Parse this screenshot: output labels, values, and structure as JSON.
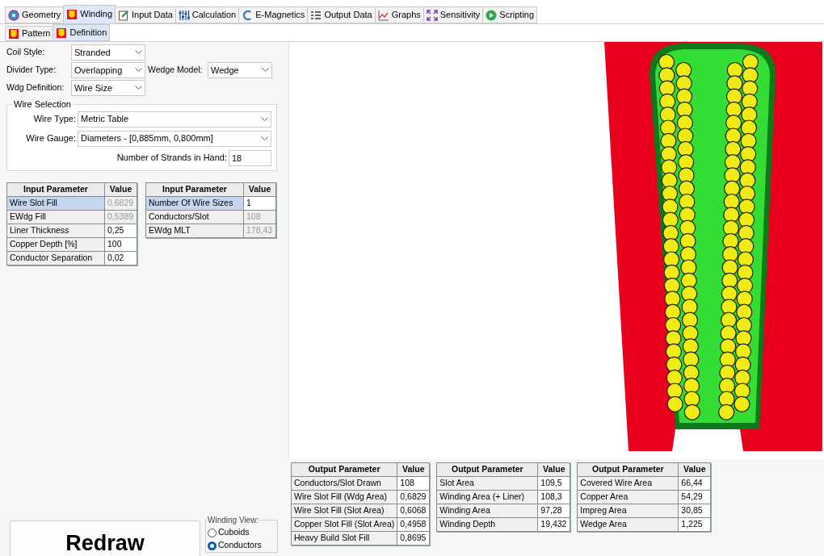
{
  "tabs": [
    {
      "label": "Geometry",
      "selected": false
    },
    {
      "label": "Winding",
      "selected": true
    },
    {
      "label": "Input Data",
      "selected": false
    },
    {
      "label": "Calculation",
      "selected": false
    },
    {
      "label": "E-Magnetics",
      "selected": false
    },
    {
      "label": "Output Data",
      "selected": false
    },
    {
      "label": "Graphs",
      "selected": false
    },
    {
      "label": "Sensitivity",
      "selected": false
    },
    {
      "label": "Scripting",
      "selected": false
    }
  ],
  "subtabs": [
    {
      "label": "Pattern",
      "selected": false
    },
    {
      "label": "Definition",
      "selected": true
    }
  ],
  "settings": {
    "coil_style": {
      "label": "Coil Style:",
      "value": "Stranded"
    },
    "divider_type": {
      "label": "Divider Type:",
      "value": "Overlapping"
    },
    "wedge_model": {
      "label": "Wedge Model:",
      "value": "Wedge"
    },
    "wdg_definition": {
      "label": "Wdg Definition:",
      "value": "Wire Size"
    }
  },
  "wire_selection": {
    "title": "Wire Selection",
    "wire_type": {
      "label": "Wire Type:",
      "value": "Metric Table"
    },
    "wire_gauge": {
      "label": "Wire Gauge:",
      "value": "Diameters  - [0,885mm, 0,800mm]"
    },
    "strands": {
      "label": "Number of Strands in Hand:",
      "value": "18"
    }
  },
  "input_tables": [
    {
      "columns": [
        "Input Parameter",
        "Value"
      ],
      "rows": [
        {
          "name": "Wire Slot Fill",
          "value": "0,6829",
          "readonly": true,
          "selected": true
        },
        {
          "name": "EWdg Fill",
          "value": "0,5389",
          "readonly": true,
          "selected": false
        },
        {
          "name": "Liner Thickness",
          "value": "0,25",
          "readonly": false,
          "selected": false
        },
        {
          "name": "Copper Depth [%]",
          "value": "100",
          "readonly": false,
          "selected": false
        },
        {
          "name": "Conductor Separation",
          "value": "0,02",
          "readonly": false,
          "selected": false
        }
      ]
    },
    {
      "columns": [
        "Input Parameter",
        "Value"
      ],
      "rows": [
        {
          "name": "Number Of Wire Sizes",
          "value": "1",
          "readonly": false,
          "selected": true
        },
        {
          "name": "Conductors/Slot",
          "value": "108",
          "readonly": true,
          "selected": false
        },
        {
          "name": "EWdg MLT",
          "value": "178,43",
          "readonly": true,
          "selected": false
        }
      ]
    }
  ],
  "output_tables": [
    {
      "columns": [
        "Output Parameter",
        "Value"
      ],
      "rows": [
        {
          "name": "Conductors/Slot Drawn",
          "value": "108"
        },
        {
          "name": "Wire Slot Fill (Wdg Area)",
          "value": "0,6829"
        },
        {
          "name": "Wire Slot Fill (Slot Area)",
          "value": "0,6068"
        },
        {
          "name": "Copper Slot Fill (Slot Area)",
          "value": "0,4958"
        },
        {
          "name": "Heavy Build Slot Fill",
          "value": "0,8695"
        }
      ]
    },
    {
      "columns": [
        "Output Parameter",
        "Value"
      ],
      "rows": [
        {
          "name": "Slot Area",
          "value": "109,5"
        },
        {
          "name": "Winding Area (+ Liner)",
          "value": "108,3"
        },
        {
          "name": "Winding Area",
          "value": "97,28"
        },
        {
          "name": "Winding Depth",
          "value": "19,432"
        }
      ]
    },
    {
      "columns": [
        "Output Parameter",
        "Value"
      ],
      "rows": [
        {
          "name": "Covered Wire Area",
          "value": "66,44"
        },
        {
          "name": "Copper Area",
          "value": "54,29"
        },
        {
          "name": "Impreg Area",
          "value": "30,85"
        },
        {
          "name": "Wedge Area",
          "value": "1,225"
        }
      ]
    }
  ],
  "redraw_button": "Redraw",
  "winding_view": {
    "title": "Winding View:",
    "options": [
      {
        "label": "Cuboids",
        "selected": false
      },
      {
        "label": "Conductors",
        "selected": true
      }
    ]
  }
}
